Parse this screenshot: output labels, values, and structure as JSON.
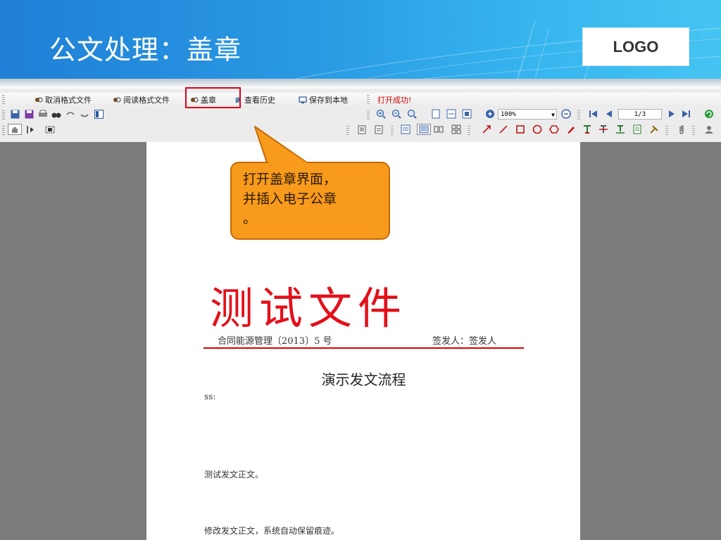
{
  "header": {
    "title": "公文处理：盖章",
    "logo_text": "LOGO"
  },
  "toolbar": {
    "menu": [
      {
        "label": "取消格式文件",
        "icon": "format-icon"
      },
      {
        "label": "阅读格式文件",
        "icon": "format-icon"
      },
      {
        "label": "盖章",
        "icon": "stamp-icon"
      },
      {
        "label": "查看历史",
        "icon": "history-icon"
      },
      {
        "label": "保存到本地",
        "icon": "save-local-icon"
      },
      {
        "label": "打开成功!",
        "icon": ""
      }
    ],
    "zoom_value": "100%",
    "page_indicator": "1/3"
  },
  "callout": {
    "line1": "打开盖章界面，",
    "line2": "并插入电子公章",
    "line3": "。"
  },
  "document": {
    "title": "测试文件",
    "doc_number": "合同能源管理〔2013〕5 号",
    "signer": "签发人：签发人",
    "heading": "演示发文流程",
    "salutation": "ss:",
    "body1": "测试发文正文。",
    "body2": "修改发文正文，系统自动保留痕迹。"
  },
  "colors": {
    "banner": "#2a9be4",
    "stamp_red": "#e3101a",
    "callout": "#f89a1c",
    "highlight": "#e0001a"
  }
}
